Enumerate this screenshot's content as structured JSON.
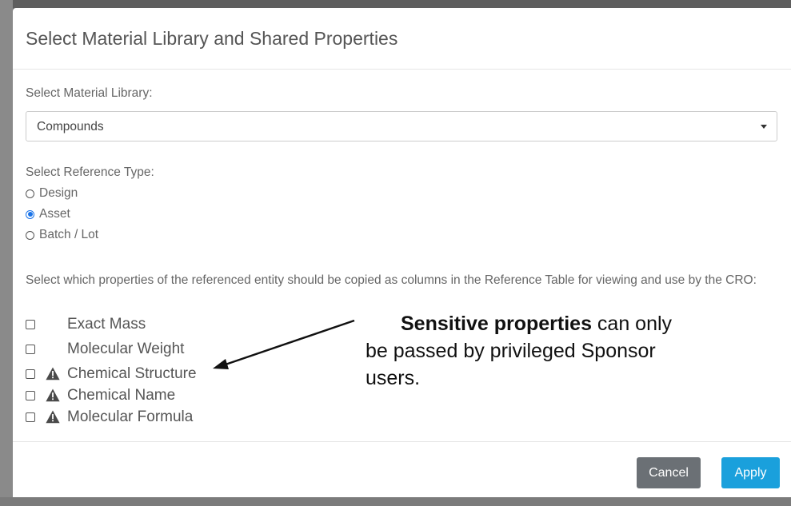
{
  "dialog": {
    "title": "Select Material Library and Shared Properties",
    "library_label": "Select Material Library:",
    "library_selected": "Compounds",
    "reference_type_label": "Select Reference Type:",
    "reference_types": [
      {
        "label": "Design",
        "checked": false
      },
      {
        "label": "Asset",
        "checked": true
      },
      {
        "label": "Batch / Lot",
        "checked": false
      }
    ],
    "properties_description": "Select which properties of the referenced entity should be copied as columns in the Reference Table for viewing and use by the CRO:",
    "properties": [
      {
        "label": "Exact Mass",
        "sensitive": false,
        "checked": false
      },
      {
        "label": "Molecular Weight",
        "sensitive": false,
        "checked": false
      },
      {
        "label": "Chemical Structure",
        "sensitive": true,
        "checked": false
      },
      {
        "label": "Chemical Name",
        "sensitive": true,
        "checked": false
      },
      {
        "label": "Molecular Formula",
        "sensitive": true,
        "checked": false
      }
    ],
    "cancel_label": "Cancel",
    "apply_label": "Apply"
  },
  "annotation": {
    "bold_text": "Sensitive properties",
    "rest_text": " can only be passed by privileged Sponsor users."
  },
  "icons": {
    "warning": "warning-triangle-icon",
    "dropdown": "caret-down-icon"
  },
  "colors": {
    "accent": "#1a73e8",
    "apply_button": "#1aa0dc",
    "cancel_button": "#6b7075"
  }
}
